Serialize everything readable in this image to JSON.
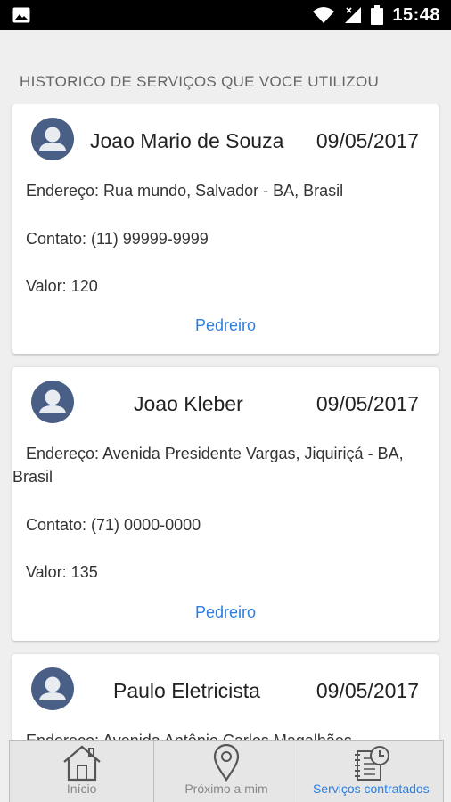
{
  "status_bar": {
    "time": "15:48"
  },
  "section_title": "HISTORICO DE SERVIÇOS QUE VOCE UTILIZOU",
  "cards": [
    {
      "name": "Joao Mario de Souza",
      "date": "09/05/2017",
      "address": "Endereço: Rua mundo, Salvador - BA, Brasil",
      "contact": "Contato: (11) 99999-9999",
      "value": "Valor: 120",
      "service": "Pedreiro"
    },
    {
      "name": "Joao Kleber",
      "date": "09/05/2017",
      "address": "Endereço: Avenida Presidente Vargas, Jiquiriçá - BA, Brasil",
      "contact": "Contato: (71) 0000-0000",
      "value": "Valor: 135",
      "service": "Pedreiro"
    },
    {
      "name": "Paulo Eletricista",
      "date": "09/05/2017",
      "address": "Endereço: Avenida Antônio Carlos Magalhães"
    }
  ],
  "bottom_nav": [
    {
      "label": "Início",
      "icon": "home-icon",
      "active": false
    },
    {
      "label": "Próximo a mim",
      "icon": "map-pin-icon",
      "active": false
    },
    {
      "label": "Serviços contratados",
      "icon": "notebook-clock-icon",
      "active": true
    }
  ]
}
